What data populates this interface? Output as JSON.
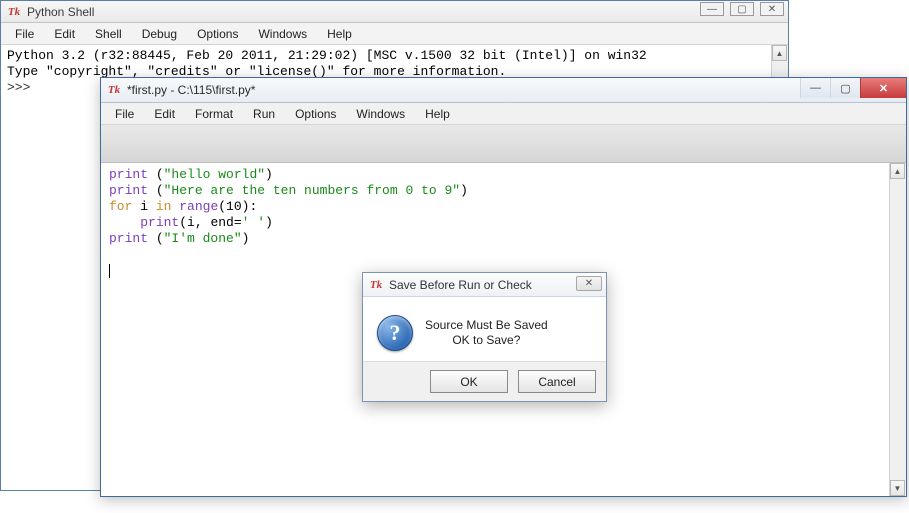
{
  "shell": {
    "title": "Python Shell",
    "menus": [
      "File",
      "Edit",
      "Shell",
      "Debug",
      "Options",
      "Windows",
      "Help"
    ],
    "banner_line1": "Python 3.2 (r32:88445, Feb 20 2011, 21:29:02) [MSC v.1500 32 bit (Intel)] on win32",
    "banner_line2": "Type \"copyright\", \"credits\" or \"license()\" for more information.",
    "prompt": ">>> "
  },
  "editor": {
    "title": "*first.py - C:\\115\\first.py*",
    "menus": [
      "File",
      "Edit",
      "Format",
      "Run",
      "Options",
      "Windows",
      "Help"
    ],
    "code": {
      "l1_fn": "print",
      "l1_rest_a": " (",
      "l1_str": "\"hello world\"",
      "l1_rest_b": ")",
      "l2_fn": "print",
      "l2_rest_a": " (",
      "l2_str": "\"Here are the ten numbers from 0 to 9\"",
      "l2_rest_b": ")",
      "l3_kw1": "for",
      "l3_mid1": " i ",
      "l3_kw2": "in",
      "l3_mid2": " ",
      "l3_fn": "range",
      "l3_rest": "(10):",
      "l4_indent": "    ",
      "l4_fn": "print",
      "l4_rest_a": "(i, end=",
      "l4_str": "' '",
      "l4_rest_b": ")",
      "l5_fn": "print",
      "l5_rest_a": " (",
      "l5_str": "\"I'm done\"",
      "l5_rest_b": ")"
    }
  },
  "dialog": {
    "title": "Save Before Run or Check",
    "msg_line1": "Source Must Be Saved",
    "msg_line2": "OK to Save?",
    "ok": "OK",
    "cancel": "Cancel"
  }
}
